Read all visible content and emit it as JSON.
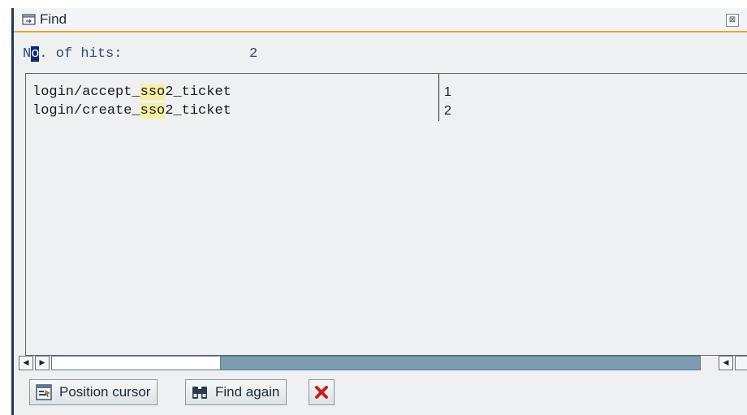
{
  "window": {
    "title": "Find",
    "close_symbol": "⊠"
  },
  "hits": {
    "label_caret": "o",
    "label_first": "N",
    "label_rest": ". of hits:",
    "count": "2"
  },
  "results": [
    {
      "prefix": "login/accept_",
      "match": "sso",
      "suffix": "2_ticket",
      "number": "1"
    },
    {
      "prefix": "login/create_",
      "match": "sso",
      "suffix": "2_ticket",
      "number": "2"
    }
  ],
  "scrollbar": {
    "left_arrow": "◀",
    "right_arrow": "▶",
    "right_end_arrow": "◀",
    "thumb_fraction": 0.26
  },
  "toolbar": {
    "position_cursor_label": "Position cursor",
    "find_again_label": "Find again"
  },
  "icons": {
    "title": "dialog-icon",
    "position_cursor": "position-cursor-icon",
    "find_again": "binoculars-icon",
    "cancel": "cancel-x-icon"
  },
  "colors": {
    "frame": "#1f3a5a",
    "accent": "#e2a43b",
    "highlight": "#f6eea0",
    "text_blue": "#2d4a78",
    "cancel_red": "#c81e1e"
  }
}
